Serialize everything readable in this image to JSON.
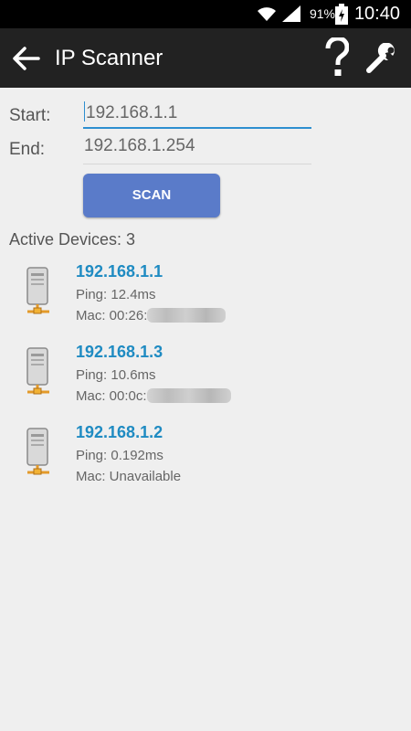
{
  "status_bar": {
    "battery_percent": "91%",
    "time": "10:40",
    "icons": [
      "wifi-icon",
      "signal-icon",
      "battery-charging-icon"
    ]
  },
  "action_bar": {
    "title": "IP Scanner",
    "icons": [
      "back-arrow-icon",
      "help-icon",
      "wrench-icon"
    ]
  },
  "form": {
    "start_label": "Start:",
    "start_value": "192.168.1.1",
    "end_label": "End:",
    "end_value": "192.168.1.254",
    "scan_label": "SCAN"
  },
  "results": {
    "active_label": "Active Devices: 3",
    "devices": [
      {
        "ip": "192.168.1.1",
        "ping": "Ping: 12.4ms",
        "mac_prefix": "Mac: 00:26:",
        "mac_redacted": true
      },
      {
        "ip": "192.168.1.3",
        "ping": "Ping: 10.6ms",
        "mac_prefix": "Mac: 00:0c:",
        "mac_redacted": true
      },
      {
        "ip": "192.168.1.2",
        "ping": "Ping: 0.192ms",
        "mac_prefix": "Mac: Unavailable",
        "mac_redacted": false
      }
    ]
  },
  "colors": {
    "action_bar": "#222222",
    "accent_blue": "#1f8bc2",
    "scan_button": "#5a7bc9",
    "background": "#efefef"
  }
}
